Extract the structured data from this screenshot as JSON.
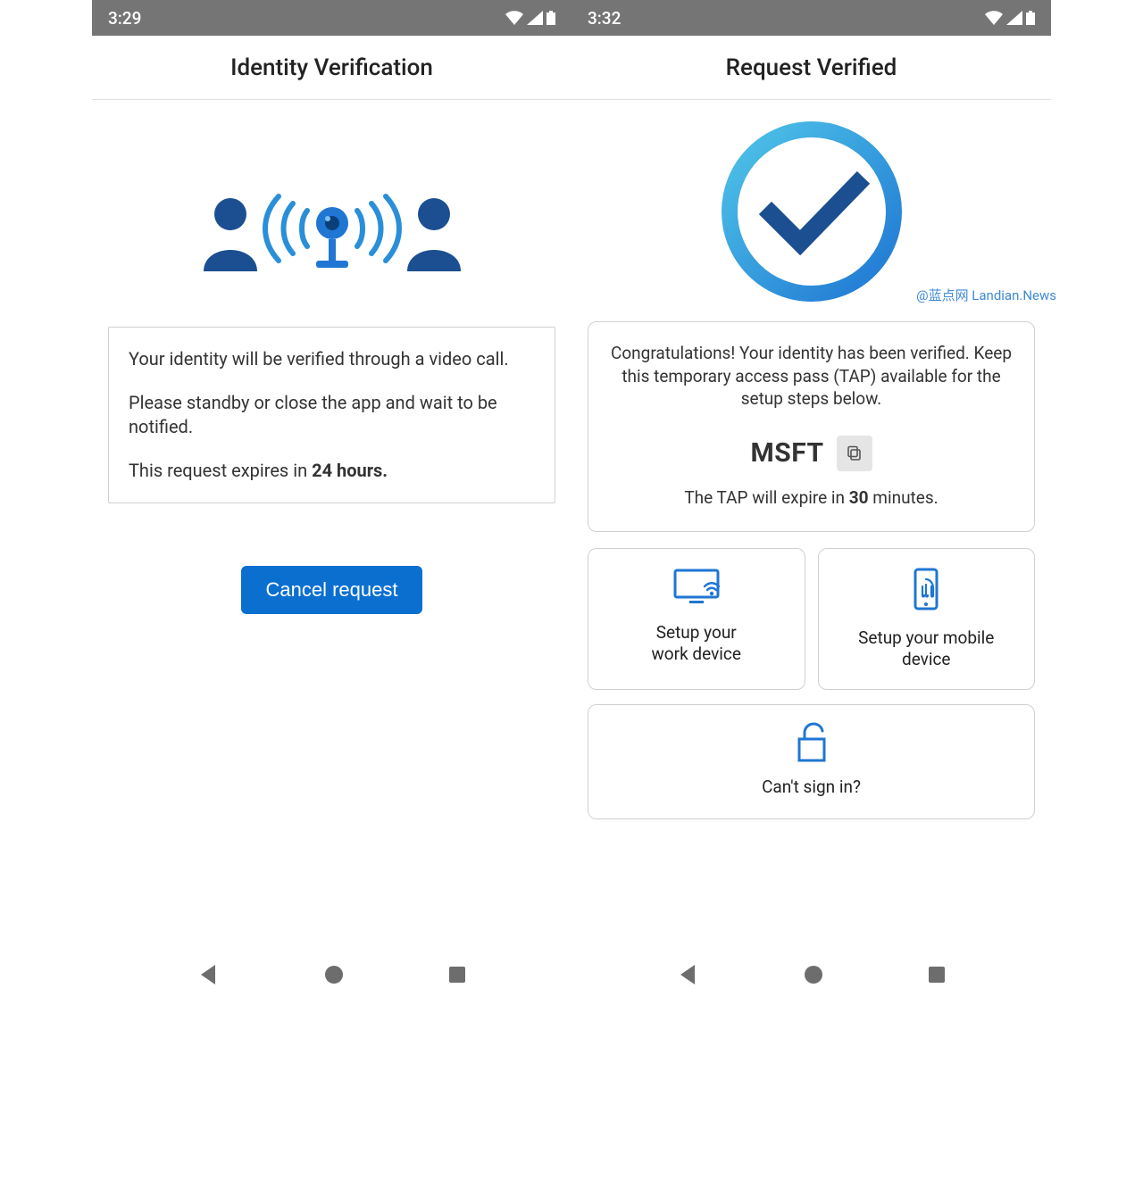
{
  "left": {
    "status_time": "3:29",
    "title": "Identity Verification",
    "info_line1": "Your identity will be verified through a video call.",
    "info_line2": "Please standby or close the app and wait to be notified.",
    "info_line3_prefix": "This request expires in ",
    "info_line3_bold": "24 hours.",
    "cancel_label": "Cancel request"
  },
  "right": {
    "status_time": "3:32",
    "title": "Request Verified",
    "congrats": "Congratulations! Your identity has been verified. Keep this temporary access pass (TAP) available for the setup steps below.",
    "tap_code": "MSFT",
    "tap_expire_prefix": "The TAP will expire in ",
    "tap_expire_bold": "30",
    "tap_expire_suffix": " minutes.",
    "action_work_l1": "Setup your",
    "action_work_l2": "work device",
    "action_mobile_l1": "Setup your mobile",
    "action_mobile_l2": "device",
    "action_signin": "Can't sign in?"
  },
  "watermark": "@蓝点网 Landian.News",
  "colors": {
    "primary_button": "#0b6fd0",
    "icon_blue": "#1f76d3",
    "person_blue": "#1b4f91",
    "check_blue": "#1b4f91"
  }
}
